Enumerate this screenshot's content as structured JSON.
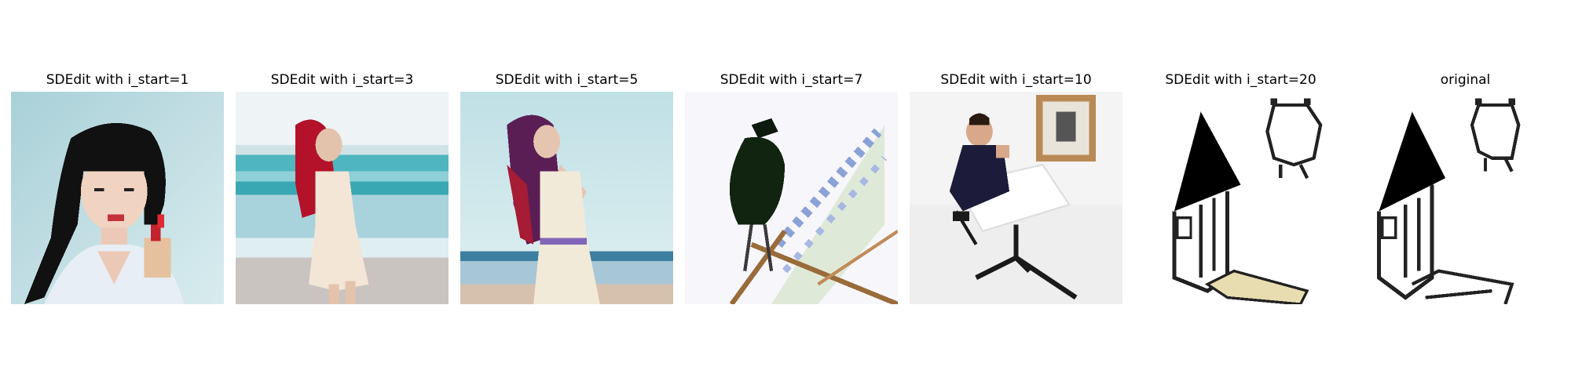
{
  "figure": {
    "panels": [
      {
        "title": "SDEdit with i_start=1",
        "image": "woman-holding-lipstick-photo"
      },
      {
        "title": "SDEdit with i_start=3",
        "image": "woman-on-beach-photo"
      },
      {
        "title": "SDEdit with i_start=5",
        "image": "woman-posing-on-beach-photo"
      },
      {
        "title": "SDEdit with i_start=7",
        "image": "black-bird-on-structure-image"
      },
      {
        "title": "SDEdit with i_start=10",
        "image": "man-sitting-at-table-image"
      },
      {
        "title": "SDEdit with i_start=20",
        "image": "house-sketch-with-color"
      },
      {
        "title": "original",
        "image": "house-line-drawing"
      }
    ]
  }
}
